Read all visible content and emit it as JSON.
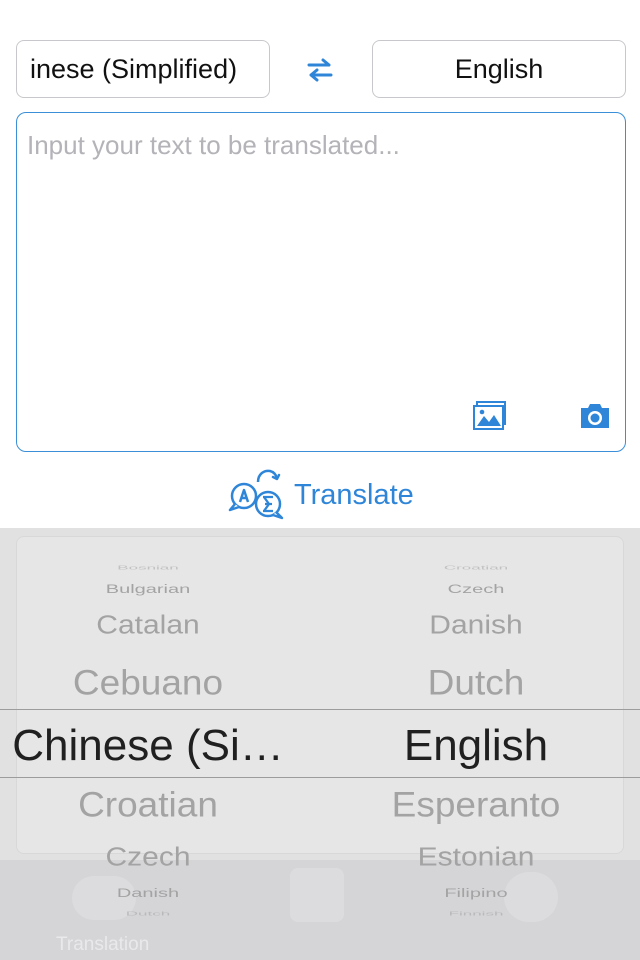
{
  "languages": {
    "source": "inese (Simplified)",
    "target": "English",
    "swap_icon": "swap-arrows-icon"
  },
  "input": {
    "placeholder": "Input your text to be translated...",
    "image_icon": "image-icon",
    "camera_icon": "camera-icon"
  },
  "translate": {
    "label": "Translate",
    "icon": "translate-bubbles-icon"
  },
  "picker": {
    "source_items": [
      "Bosnian",
      "Bulgarian",
      "Catalan",
      "Cebuano",
      "Chinese (Si…",
      "Croatian",
      "Czech",
      "Danish",
      "Dutch"
    ],
    "target_items": [
      "Croatian",
      "Czech",
      "Danish",
      "Dutch",
      "English",
      "Esperanto",
      "Estonian",
      "Filipino",
      "Finnish"
    ],
    "selected_index": 4
  },
  "tabbar": {
    "first_tab_label": "Translation"
  },
  "colors": {
    "accent": "#2f86d8",
    "border_active": "#3a8fd8",
    "picker_bg": "#e1e1e1"
  }
}
